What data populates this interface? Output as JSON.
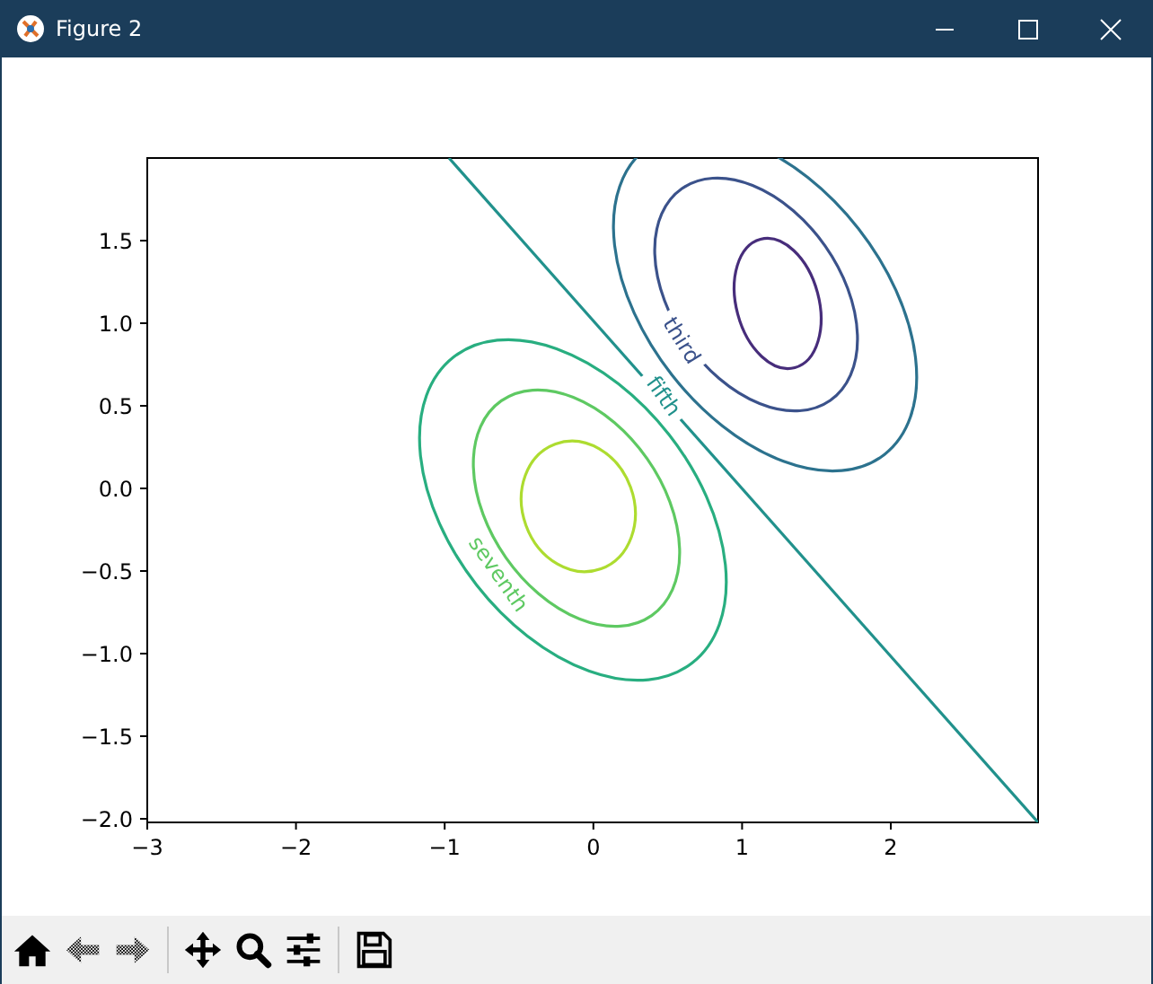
{
  "window": {
    "title": "Figure 2"
  },
  "plot": {
    "xticks": [
      "−3",
      "−2",
      "−1",
      "0",
      "1",
      "2"
    ],
    "yticks": [
      "1.5",
      "1.0",
      "0.5",
      "0.0",
      "−0.5",
      "−1.0",
      "−1.5",
      "−2.0"
    ],
    "contour_labels": [
      {
        "text": "third",
        "color": "#3b528b"
      },
      {
        "text": "fifth",
        "color": "#21918c"
      },
      {
        "text": "seventh",
        "color": "#5ec962"
      }
    ]
  },
  "toolbar": [
    {
      "kind": "home",
      "disabled": false
    },
    {
      "kind": "back",
      "disabled": true
    },
    {
      "kind": "forward",
      "disabled": true
    },
    {
      "kind": "separator"
    },
    {
      "kind": "pan",
      "disabled": false
    },
    {
      "kind": "zoom",
      "disabled": false
    },
    {
      "kind": "configure",
      "disabled": false
    },
    {
      "kind": "separator"
    },
    {
      "kind": "save",
      "disabled": false
    }
  ]
}
